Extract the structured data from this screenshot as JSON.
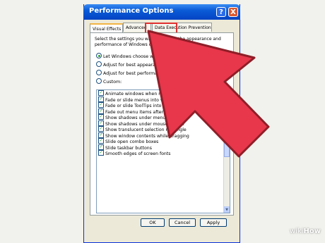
{
  "window": {
    "title": "Performance Options"
  },
  "title_buttons": {
    "help": "?",
    "close": "X"
  },
  "tabs": [
    "Visual Effects",
    "Advanced",
    "Data Execution Prevention"
  ],
  "intro_text": "Select the settings you want to use for the appearance and performance of Windows on this computer.",
  "options": [
    {
      "label": "Let Windows choose what's best for my computer",
      "selected": true
    },
    {
      "label": "Adjust for best appearance",
      "selected": false
    },
    {
      "label": "Adjust for best performance",
      "selected": false
    },
    {
      "label": "Custom:",
      "selected": false
    }
  ],
  "effects": [
    "Animate windows when minimizing and maximizing",
    "Fade or slide menus into view",
    "Fade or slide ToolTips into view",
    "Fade out menu items after clicking",
    "Show shadows under menus",
    "Show shadows under mouse pointer",
    "Show translucent selection rectangle",
    "Show window contents while dragging",
    "Slide open combo boxes",
    "Slide taskbar buttons",
    "Smooth edges of screen fonts"
  ],
  "buttons": {
    "ok": "OK",
    "cancel": "Cancel",
    "apply": "Apply"
  },
  "watermark": {
    "brand": "wiki",
    "suffix": "How"
  },
  "colors": {
    "arrow": "#e8364a",
    "highlight": "#e03030"
  }
}
